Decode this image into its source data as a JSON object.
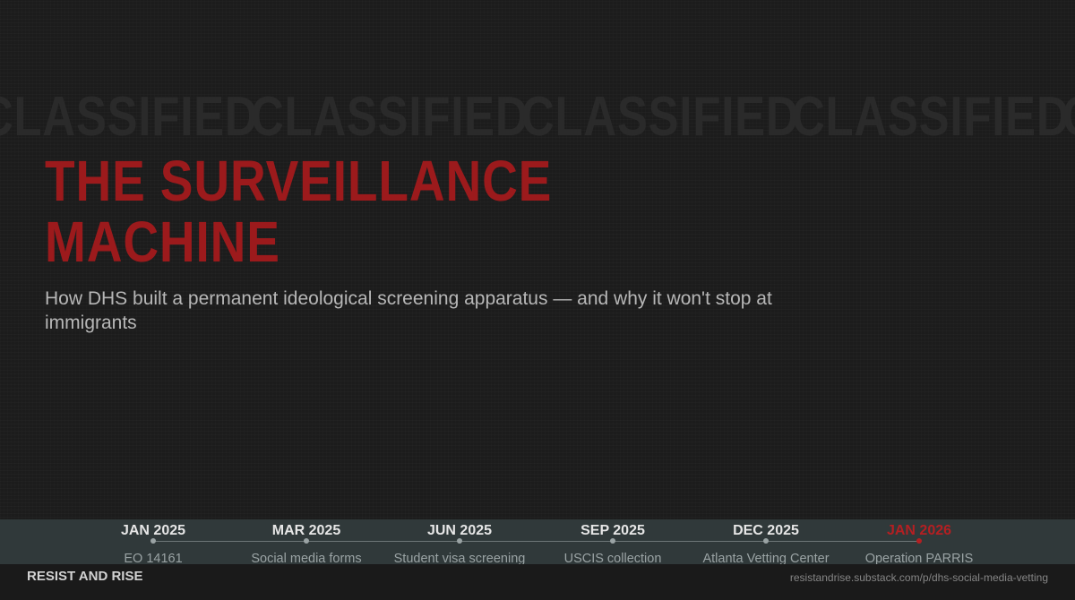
{
  "watermark": {
    "words": [
      "CLASSIFIED",
      "CLASSIFIED",
      "CLASSIFIED",
      "CLASSIFIED",
      "CLASSIFIED"
    ]
  },
  "header": {
    "title": "THE SURVEILLANCE MACHINE",
    "subtitle": "How DHS built a permanent ideological screening apparatus — and why it won't stop at immigrants"
  },
  "timeline": {
    "items": [
      {
        "date": "JAN 2025",
        "label": "EO 14161",
        "highlight": false
      },
      {
        "date": "MAR 2025",
        "label": "Social media forms",
        "highlight": false
      },
      {
        "date": "JUN 2025",
        "label": "Student visa screening",
        "highlight": false
      },
      {
        "date": "SEP 2025",
        "label": "USCIS collection",
        "highlight": false
      },
      {
        "date": "DEC 2025",
        "label": "Atlanta Vetting Center",
        "highlight": false
      },
      {
        "date": "JAN 2026",
        "label": "Operation PARRIS",
        "highlight": true
      }
    ]
  },
  "footer": {
    "brand": "RESIST AND RISE",
    "url": "resistandrise.substack.com/p/dhs-social-media-vetting"
  },
  "colors": {
    "background": "#1c1c1c",
    "accent_red": "#9c1a1c",
    "timeline_band": "#30393a"
  }
}
